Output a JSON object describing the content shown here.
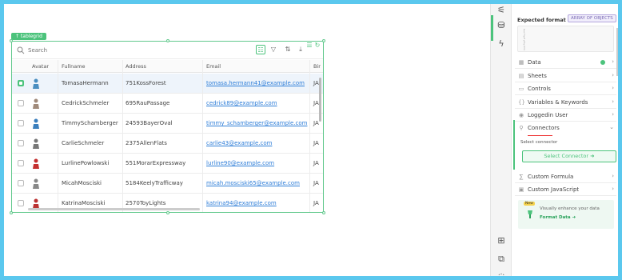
{
  "widget": {
    "tag": "↑ tablegrid",
    "search_placeholder": "Search",
    "columns": [
      "Avatar",
      "Fullname",
      "Address",
      "Email",
      "Bir"
    ],
    "rows": [
      {
        "name": "TomasaHermann",
        "address": "751KossForest",
        "email": "tomasa.hermann41@example.com",
        "birth": "JA",
        "selected": true,
        "avatar_color": "#4a8ec0"
      },
      {
        "name": "CedrickSchmeler",
        "address": "695RauPassage",
        "email": "cedrick89@example.com",
        "birth": "JA",
        "selected": false,
        "avatar_color": "#a08a7a"
      },
      {
        "name": "TimmySchamberger",
        "address": "24593BayerOval",
        "email": "timmy_schamberger@example.com",
        "birth": "JA",
        "selected": false,
        "avatar_color": "#3b7fbd"
      },
      {
        "name": "CarlieSchmeler",
        "address": "2375AllenFlats",
        "email": "carlie43@example.com",
        "birth": "JA",
        "selected": false,
        "avatar_color": "#777777"
      },
      {
        "name": "LurlinePowlowski",
        "address": "551MorarExpressway",
        "email": "lurline90@example.com",
        "birth": "JA",
        "selected": false,
        "avatar_color": "#c43030"
      },
      {
        "name": "MicahMosciski",
        "address": "5184KeelyTrafficway",
        "email": "micah.mosciski65@example.com",
        "birth": "JA",
        "selected": false,
        "avatar_color": "#888888"
      },
      {
        "name": "KatrinaMosciski",
        "address": "2570ToyLights",
        "email": "katrina94@example.com",
        "birth": "JA",
        "selected": false,
        "avatar_color": "#b33"
      }
    ]
  },
  "panel": {
    "expected_format_label": "Expected format",
    "format_badge": "ARRAY OF OBJECTS",
    "code_lines": [
      "[",
      "  {",
      "  }",
      "]"
    ],
    "sections": [
      {
        "label": "Data",
        "icon": "▦",
        "has_dot": true
      },
      {
        "label": "Sheets",
        "icon": "▤",
        "has_dot": false
      },
      {
        "label": "Controls",
        "icon": "▭",
        "has_dot": false
      },
      {
        "label": "Variables & Keywords",
        "icon": "{}",
        "has_dot": false
      },
      {
        "label": "Loggedin User",
        "icon": "◉",
        "has_dot": false
      },
      {
        "label": "Connectors",
        "icon": "⚲",
        "has_dot": false
      }
    ],
    "connectors": {
      "select_label": "Select connector",
      "button_label": "Select Connector ➜"
    },
    "lower_sections": [
      {
        "label": "Custom Formula",
        "icon": "∑"
      },
      {
        "label": "Custom JavaScript",
        "icon": "▣"
      }
    ],
    "promo": {
      "badge": "New",
      "text": "Visually enhance your data",
      "link": "Format Data ➜"
    }
  },
  "colors": {
    "accent": "#4cc37c",
    "link": "#2f7ed8",
    "outer": "#5bc8ee"
  }
}
